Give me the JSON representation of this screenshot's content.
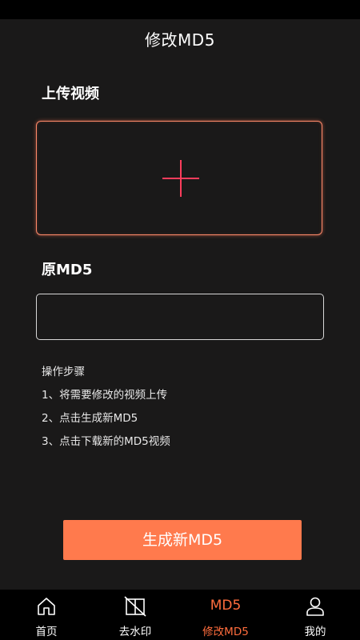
{
  "header": {
    "title": "修改MD5"
  },
  "upload": {
    "label": "上传视频"
  },
  "md5": {
    "label": "原MD5",
    "value": ""
  },
  "steps": {
    "title": "操作步骤",
    "items": [
      "1、将需要修改的视频上传",
      "2、点击生成新MD5",
      "3、点击下载新的MD5视频"
    ]
  },
  "actions": {
    "generate_label": "生成新MD5"
  },
  "tabbar": {
    "tabs": [
      {
        "label": "首页",
        "icon": "home-icon"
      },
      {
        "label": "去水印",
        "icon": "remove-watermark-icon"
      },
      {
        "label": "修改MD5",
        "icon_text": "MD5",
        "active": true
      },
      {
        "label": "我的",
        "icon": "profile-icon"
      }
    ]
  },
  "colors": {
    "background": "#1a1919",
    "accent": "#ff7a4d",
    "active_tab": "#ff6d3d",
    "upload_border": "#ff8a6a",
    "plus": "#ff3d5c"
  }
}
